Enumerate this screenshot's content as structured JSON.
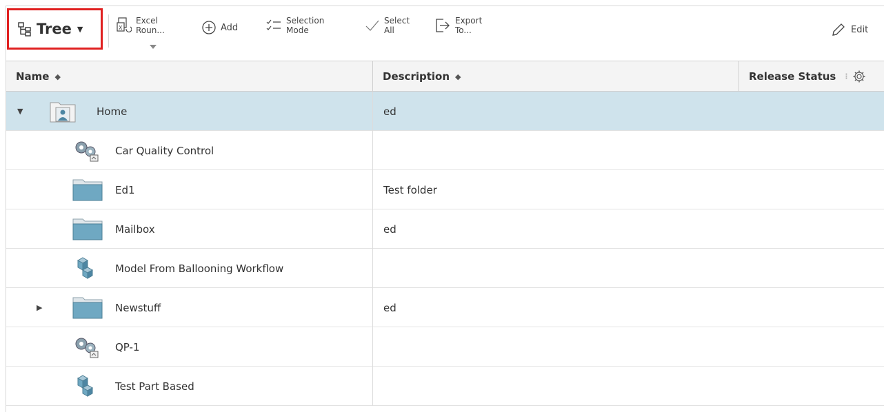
{
  "toolbar": {
    "tree_label": "Tree",
    "excel_line1": "Excel",
    "excel_line2": "Roun...",
    "add_label": "Add",
    "selection_line1": "Selection",
    "selection_line2": "Mode",
    "select_line1": "Select",
    "select_line2": "All",
    "export_line1": "Export",
    "export_line2": "To...",
    "edit_label": "Edit"
  },
  "columns": {
    "name": "Name",
    "description": "Description",
    "release_status": "Release Status"
  },
  "rows": [
    {
      "name": "Home",
      "description": "ed",
      "icon": "home-folder-icon"
    },
    {
      "name": "Car Quality Control",
      "description": "",
      "icon": "gears-icon"
    },
    {
      "name": "Ed1",
      "description": "Test folder",
      "icon": "folder-icon"
    },
    {
      "name": "Mailbox",
      "description": "ed",
      "icon": "folder-icon"
    },
    {
      "name": "Model From Ballooning Workflow",
      "description": "",
      "icon": "part-cubes-icon"
    },
    {
      "name": "Newstuff",
      "description": "ed",
      "icon": "folder-icon"
    },
    {
      "name": "QP-1",
      "description": "",
      "icon": "gears-icon"
    },
    {
      "name": "Test Part Based",
      "description": "",
      "icon": "part-cubes-icon"
    }
  ],
  "colors": {
    "selected_row": "#cfe3ec",
    "highlight_border": "#e02020",
    "folder_blue": "#6fa8c2"
  }
}
